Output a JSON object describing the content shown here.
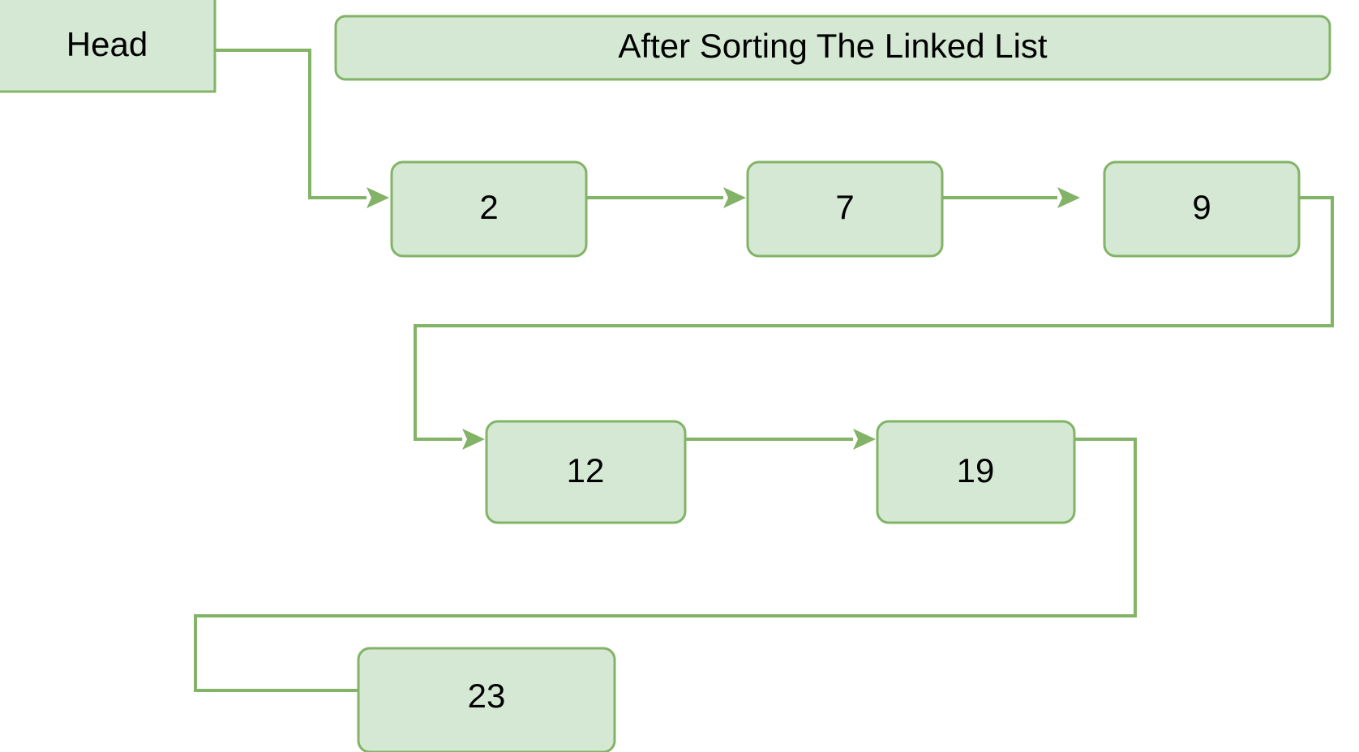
{
  "diagram": {
    "kind": "linked-list",
    "title_box": {
      "label": "After Sorting The Linked List"
    },
    "head_box": {
      "label": "Head"
    },
    "colors": {
      "node_fill": "#d5e8d4",
      "node_stroke": "#82b366",
      "edge_stroke": "#82b366",
      "text": "#000000",
      "background": "#ffffff"
    },
    "nodes": [
      {
        "id": "n1",
        "label": "2"
      },
      {
        "id": "n2",
        "label": "7"
      },
      {
        "id": "n3",
        "label": "9"
      },
      {
        "id": "n4",
        "label": "12"
      },
      {
        "id": "n5",
        "label": "19"
      },
      {
        "id": "n6",
        "label": "23"
      }
    ],
    "edges": [
      {
        "from": "head",
        "to": "n1",
        "arrow": true
      },
      {
        "from": "n1",
        "to": "n2",
        "arrow": true
      },
      {
        "from": "n2",
        "to": "n3",
        "arrow": true
      },
      {
        "from": "n3",
        "to": "n4",
        "arrow": true
      },
      {
        "from": "n4",
        "to": "n5",
        "arrow": true
      },
      {
        "from": "n5",
        "to": "n6",
        "arrow": false
      }
    ]
  }
}
